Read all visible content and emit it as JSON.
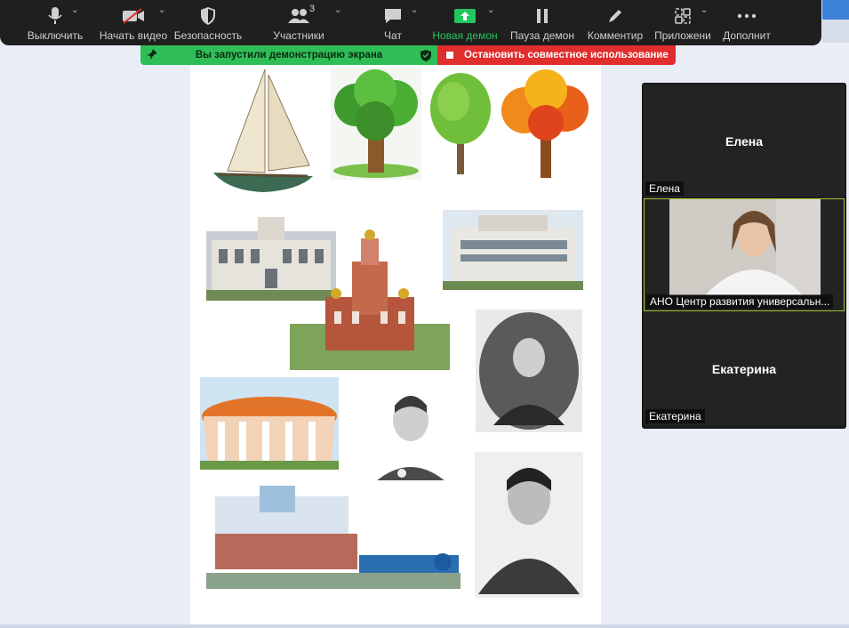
{
  "toolbar": {
    "items": [
      {
        "label": "Выключить",
        "icon": "microphone-icon"
      },
      {
        "label": "Начать видео",
        "icon": "video-off-icon"
      },
      {
        "label": "Безопасность",
        "icon": "shield-icon"
      },
      {
        "label": "Участники",
        "icon": "participants-icon",
        "count": "3"
      },
      {
        "label": "Чат",
        "icon": "chat-icon"
      },
      {
        "label": "Новая демон",
        "icon": "share-screen-icon",
        "accent": "#22c55e"
      },
      {
        "label": "Пауза демон",
        "icon": "pause-icon"
      },
      {
        "label": "Комментир",
        "icon": "pencil-icon"
      },
      {
        "label": "Приложени",
        "icon": "apps-icon"
      },
      {
        "label": "Дополнит",
        "icon": "more-icon"
      }
    ]
  },
  "share": {
    "banner_text": "Вы запустили демонстрацию экрана",
    "stop_text": "Остановить совместное использование",
    "banner_color": "#2fbd57",
    "stop_color": "#e02d2d"
  },
  "participants": {
    "tiles": [
      {
        "center_name": "Елена",
        "tag": "Елена"
      },
      {
        "center_name": "",
        "tag": "АНО Центр развития универсальн..."
      },
      {
        "center_name": "Екатерина",
        "tag": "Екатерина"
      }
    ]
  }
}
